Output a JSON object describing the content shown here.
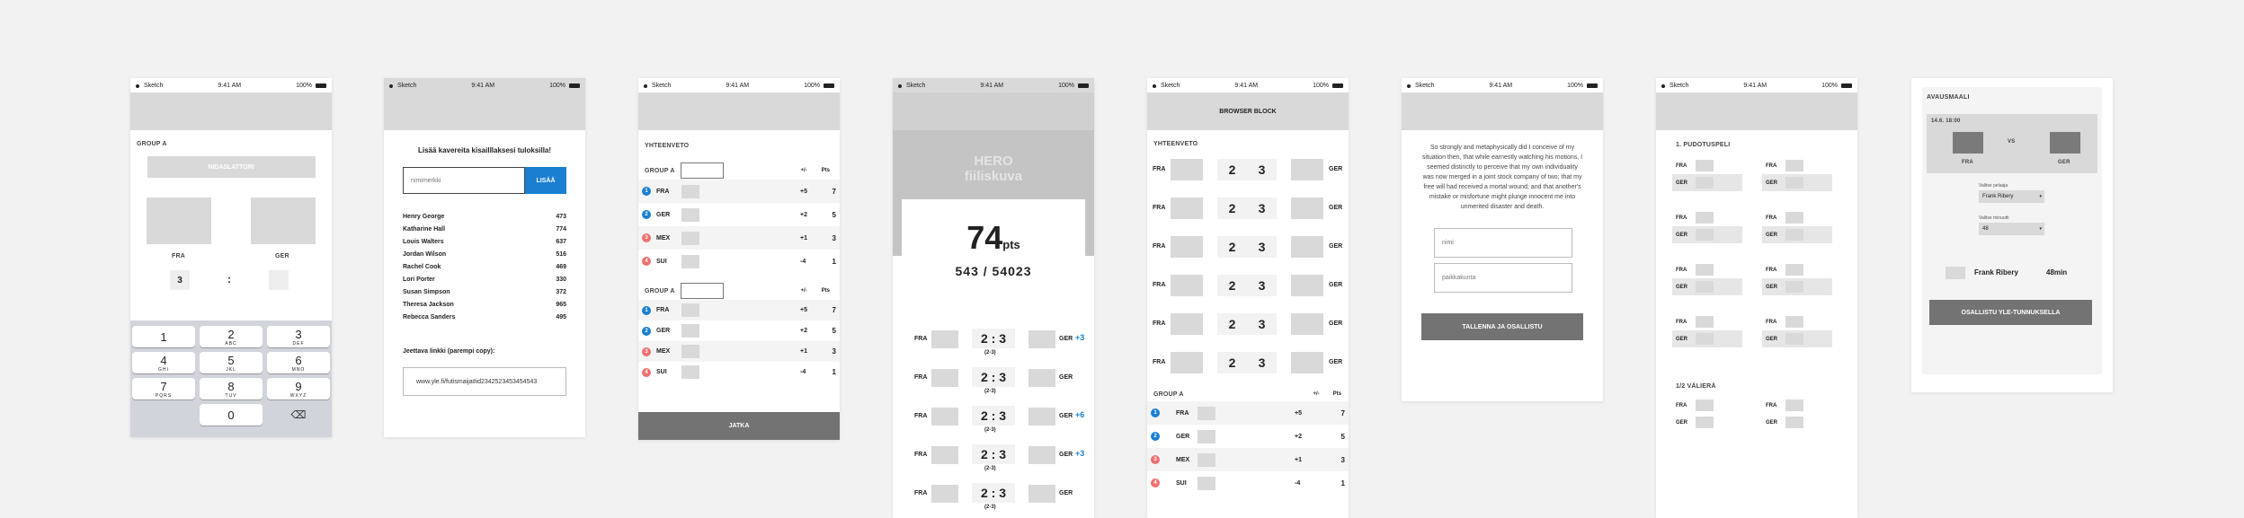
{
  "status": {
    "carrier": "Sketch",
    "time": "9:41 AM",
    "battery": "100%"
  },
  "s1": {
    "group": "GROUP A",
    "predict_btn": "NIDASLATTORI",
    "team1": "FRA",
    "team2": "GER",
    "score1": "3",
    "sep": ":",
    "keys": [
      {
        "d": "1",
        "l": ""
      },
      {
        "d": "2",
        "l": "ABC"
      },
      {
        "d": "3",
        "l": "DEF"
      },
      {
        "d": "4",
        "l": "GHI"
      },
      {
        "d": "5",
        "l": "JKL"
      },
      {
        "d": "6",
        "l": "MNO"
      },
      {
        "d": "7",
        "l": "PQRS"
      },
      {
        "d": "8",
        "l": "TUV"
      },
      {
        "d": "9",
        "l": "WXYZ"
      }
    ],
    "zero": "0",
    "delete": "⌫"
  },
  "s2": {
    "title": "Lisää kavereita kisailllaksesi tuloksilla!",
    "input_placeholder": "nimimerkki",
    "add_btn": "LISÄÄ",
    "friends": [
      {
        "name": "Henry George",
        "pts": "473"
      },
      {
        "name": "Katharine Hall",
        "pts": "774"
      },
      {
        "name": "Louis Walters",
        "pts": "637"
      },
      {
        "name": "Jordan Wilson",
        "pts": "516"
      },
      {
        "name": "Rachel Cook",
        "pts": "469"
      },
      {
        "name": "Lori Porter",
        "pts": "330"
      },
      {
        "name": "Susan Simpson",
        "pts": "372"
      },
      {
        "name": "Theresa Jackson",
        "pts": "965"
      },
      {
        "name": "Rebecca Sanders",
        "pts": "495"
      }
    ],
    "share_label": "Jeettava linkki (parempi copy):",
    "share_url": "www.yle.fi/futismaija#id2342523453454543"
  },
  "s3": {
    "section": "YHTEENVETO",
    "group": "GROUP A",
    "col_diff": "+/-",
    "col_pts": "Pts",
    "rows": [
      {
        "n": "1",
        "team": "FRA",
        "diff": "+5",
        "pts": "7"
      },
      {
        "n": "2",
        "team": "GER",
        "diff": "+2",
        "pts": "5"
      },
      {
        "n": "3",
        "team": "MEX",
        "diff": "+1",
        "pts": "3"
      },
      {
        "n": "4",
        "team": "SUI",
        "diff": "-4",
        "pts": "1"
      }
    ],
    "continue_btn": "JATKA"
  },
  "s4": {
    "hero_line1": "HERO",
    "hero_line2": "fiiliskuva",
    "points": "74",
    "points_unit": "pts",
    "rank": "543 / 54023",
    "matches": [
      {
        "t1": "FRA",
        "t2": "GER",
        "score": "2 : 3",
        "sub": "(2-3)",
        "bonus": "+3"
      },
      {
        "t1": "FRA",
        "t2": "GER",
        "score": "2 : 3",
        "sub": "(2-3)",
        "bonus": ""
      },
      {
        "t1": "FRA",
        "t2": "GER",
        "score": "2 : 3",
        "sub": "(2-3)",
        "bonus": "+6"
      },
      {
        "t1": "FRA",
        "t2": "GER",
        "score": "2 : 3",
        "sub": "(2-3)",
        "bonus": "+3"
      },
      {
        "t1": "FRA",
        "t2": "GER",
        "score": "2 : 3",
        "sub": "(2-3)",
        "bonus": ""
      }
    ]
  },
  "s5": {
    "block": "BROWSER BLOCK",
    "section": "YHTEENVETO",
    "group": "GROUP A",
    "col_diff": "+/-",
    "col_pts": "Pts",
    "matches": [
      {
        "t1": "FRA",
        "t2": "GER",
        "s1": "2",
        "s2": "3"
      },
      {
        "t1": "FRA",
        "t2": "GER",
        "s1": "2",
        "s2": "3"
      },
      {
        "t1": "FRA",
        "t2": "GER",
        "s1": "2",
        "s2": "3"
      },
      {
        "t1": "FRA",
        "t2": "GER",
        "s1": "2",
        "s2": "3"
      },
      {
        "t1": "FRA",
        "t2": "GER",
        "s1": "2",
        "s2": "3"
      },
      {
        "t1": "FRA",
        "t2": "GER",
        "s1": "2",
        "s2": "3"
      }
    ],
    "rows": [
      {
        "n": "1",
        "team": "FRA",
        "diff": "+5",
        "pts": "7"
      },
      {
        "n": "2",
        "team": "GER",
        "diff": "+2",
        "pts": "5"
      },
      {
        "n": "3",
        "team": "MEX",
        "diff": "+1",
        "pts": "3"
      },
      {
        "n": "4",
        "team": "SUI",
        "diff": "-4",
        "pts": "1"
      }
    ]
  },
  "s6": {
    "body": "So strongly and metaphysically did I conceive of my situation then, that while earnestly watching his motions, I seemed distinctly to perceive that my own individuality was now merged in a joint stock company of two; that my free will had received a mortal wound; and that another's mistake or misfortune might plunge innocent me into unmerited disaster and death.",
    "name_placeholder": "nimi",
    "city_placeholder": "paikkakunta",
    "submit_btn": "TALLENNA JA OSALLISTU"
  },
  "s7": {
    "round1": "1. PUDOTUSPELI",
    "round2": "1/2 VÄLIERÄ",
    "team1": "FRA",
    "team2": "GER"
  },
  "s8": {
    "title": "AVAUSMAALI",
    "date": "14.6. 18:00",
    "vs": "VS",
    "team1": "FRA",
    "team2": "GER",
    "player_label": "Valitse pelaaja",
    "player_value": "Frank Ribery",
    "minute_label": "Valitse minuutti",
    "minute_value": "48",
    "summary_player": "Frank Ribery",
    "summary_min": "48min",
    "cta": "OSALLISTU YLE-TUNNUKSELLA"
  }
}
